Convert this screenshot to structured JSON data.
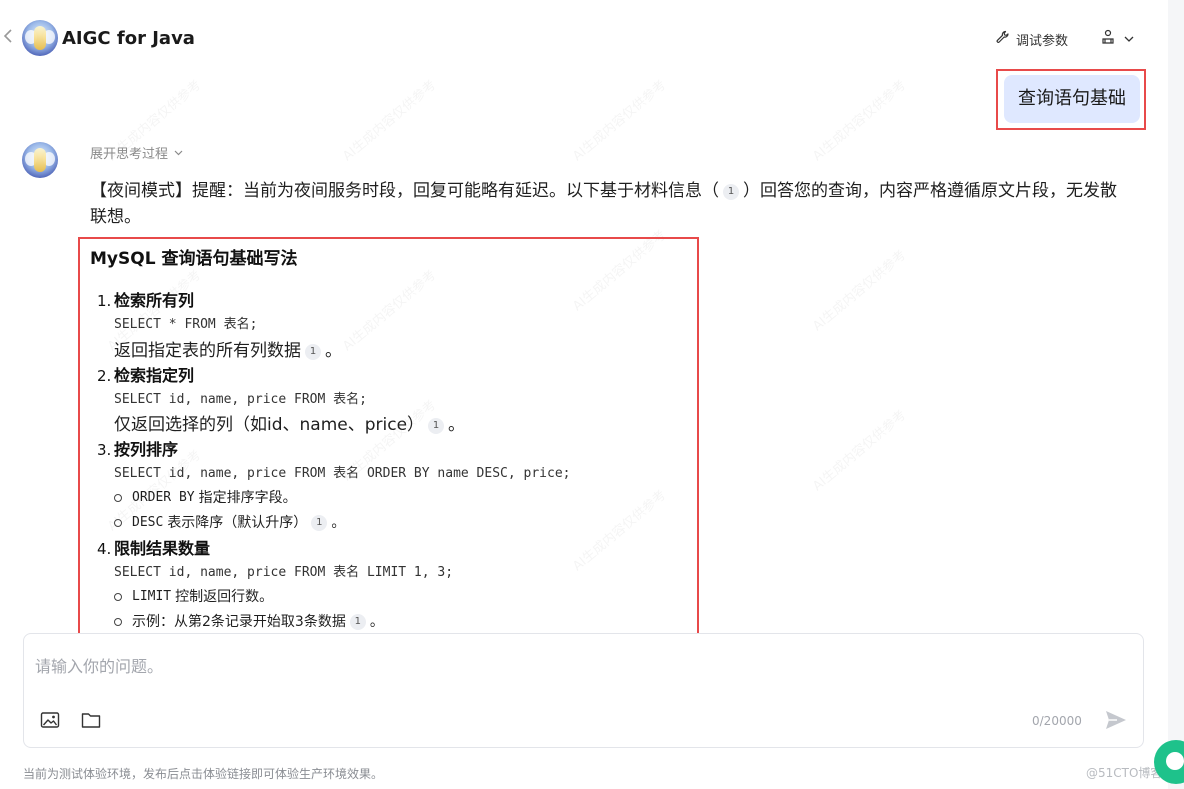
{
  "header": {
    "back_icon": "chevron-left-icon",
    "app_title": "AIGC for Java",
    "debug_label": "调试参数",
    "debug_icon": "wrench-icon",
    "share_icon": "person-icon"
  },
  "user_message": "查询语句基础",
  "bot": {
    "think_toggle": "展开思考过程",
    "notice_part1": "【夜间模式】提醒：当前为夜间服务时段，回复可能略有延迟。以下基于材料信息（",
    "notice_cite": "1",
    "notice_part2": "）回答您的查询，内容严格遵循原文片段，无发散联想。",
    "answer_title": "MySQL 查询语句基础写法",
    "sections": [
      {
        "num": "1.",
        "title": "检索所有列",
        "code": "SELECT * FROM 表名;",
        "desc": "返回指定表的所有列数据",
        "cite": "1",
        "tail": "。"
      },
      {
        "num": "2.",
        "title": "检索指定列",
        "code": "SELECT id, name, price FROM 表名;",
        "desc": "仅返回选择的列（如id、name、price）",
        "cite": "1",
        "tail": "。"
      },
      {
        "num": "3.",
        "title": "按列排序",
        "code": "SELECT id, name, price FROM 表名 ORDER BY name DESC, price;",
        "bullets": [
          {
            "mono": "ORDER BY",
            "text": "指定排序字段。",
            "cite": ""
          },
          {
            "mono": "DESC",
            "text": "表示降序（默认升序）",
            "cite": "1",
            "tail": "。"
          }
        ]
      },
      {
        "num": "4.",
        "title": "限制结果数量",
        "code": "SELECT id, name, price FROM 表名 LIMIT 1, 3;",
        "bullets": [
          {
            "mono": "LIMIT",
            "text": "控制返回行数。",
            "cite": ""
          },
          {
            "mono": "",
            "text": "示例：从第2条记录开始取3条数据",
            "cite": "1",
            "tail": "。"
          }
        ]
      }
    ]
  },
  "input": {
    "placeholder": "请输入你的问题。",
    "counter": "0/20000",
    "image_icon": "image-icon",
    "folder_icon": "folder-icon",
    "send_icon": "send-icon"
  },
  "footer": {
    "note": "当前为测试体验环境，发布后点击体验链接即可体验生产环境效果。",
    "badge": "@51CTO博客"
  },
  "colors": {
    "highlight_border": "#e84a4a",
    "user_bubble": "#dfe8ff",
    "float_button": "#1ec28b"
  }
}
